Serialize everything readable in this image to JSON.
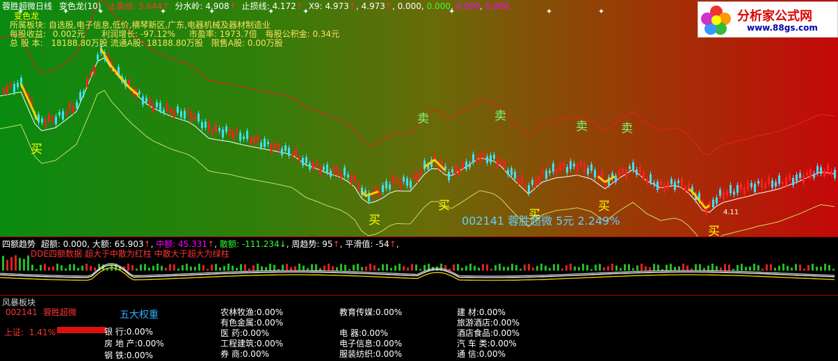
{
  "header": {
    "title": "蓉胜超微",
    "period": "日线",
    "indicator": "变色龙(10)",
    "zhiying_label": "止盈线:",
    "zhiying_val": "5.644",
    "fenshuiling_label": "分水岭:",
    "fenshuiling_val": "4.908",
    "zhisun_label": "止损线:",
    "zhisun_val": "4.172",
    "x9_label": "X9:",
    "x9_val": "4.973",
    "v1": "4.973",
    "v2": "0.000",
    "v3": "0.000",
    "v4": "0.000",
    "v5": "0.000,"
  },
  "info": {
    "bianselong": "变色龙",
    "line1_label": "所属板块:",
    "line1_val": "自选股,电子信息,低价,横琴新区,广东,电器机械及器材制造业",
    "mgsy_label": "每股收益:",
    "mgsy_val": "0.002元",
    "lrzz_label": "利润增长:",
    "lrzz_val": "-97.12%",
    "syl_label": "市盈率:",
    "syl_val": "1973.7倍",
    "gjj_label": "每股公积金:",
    "gjj_val": "0.34元",
    "zgb_label": "总 股 本:",
    "zgb_val": "18188.80万股",
    "ltag_label": "流通A股:",
    "ltag_val": "18188.80万股",
    "xsag_label": "限售A股:",
    "xsag_val": "0.00万股"
  },
  "chart_labels": {
    "buy": "买",
    "sell": "卖",
    "low_price": "4.11",
    "stock_banner": "002141 蓉胜超微 5元 2.249%"
  },
  "sub": {
    "name": "四额趋势",
    "chaoe_label": "超额:",
    "chaoe_val": "0.000",
    "dae_label": "大额:",
    "dae_val": "65.903",
    "zhonge_label": "中额:",
    "zhonge_val": "45.331",
    "sane_label": "散额:",
    "sane_val": "-111.234",
    "zqs_label": "周趋势:",
    "zqs_val": "95",
    "phz_label": "平滑值:",
    "phz_val": "-54",
    "note": "DDE四额数据   超大于中散为红柱   中散大于超大为绿柱"
  },
  "bottom": {
    "panel_title": "风暴板块",
    "code": "002141",
    "name": "蓉胜超微",
    "index_label": "上证:",
    "index_val": "1.41%",
    "heading": "五大权重",
    "col1": [
      {
        "name": "银    行:",
        "val": "0.00%"
      },
      {
        "name": "房 地 产:",
        "val": "0.00%"
      },
      {
        "name": "钢    铁:",
        "val": "0.00%"
      }
    ],
    "col2": [
      {
        "name": "农林牧渔:",
        "val": "0.00%"
      },
      {
        "name": "有色金属:",
        "val": "0.00%"
      },
      {
        "name": "医    药:",
        "val": "0.00%"
      },
      {
        "name": "工程建筑:",
        "val": "0.00%"
      },
      {
        "name": "券    商:",
        "val": "0.00%"
      }
    ],
    "col3": [
      {
        "name": "教育传媒:",
        "val": "0.00%"
      },
      {
        "name": "",
        "val": ""
      },
      {
        "name": "电    器:",
        "val": "0.00%"
      },
      {
        "name": "电子信息:",
        "val": "0.00%"
      },
      {
        "name": "服装纺织:",
        "val": "0.00%"
      }
    ],
    "col4": [
      {
        "name": "建    材:",
        "val": "0.00%"
      },
      {
        "name": "旅游酒店:",
        "val": "0.00%"
      },
      {
        "name": "酒店食品:",
        "val": "0.00%"
      },
      {
        "name": "汽 车 类:",
        "val": "0.00%"
      },
      {
        "name": "通    信:",
        "val": "0.00%"
      }
    ]
  },
  "logo": {
    "text": "分析家公式网",
    "url": "www.88gs.com"
  }
}
